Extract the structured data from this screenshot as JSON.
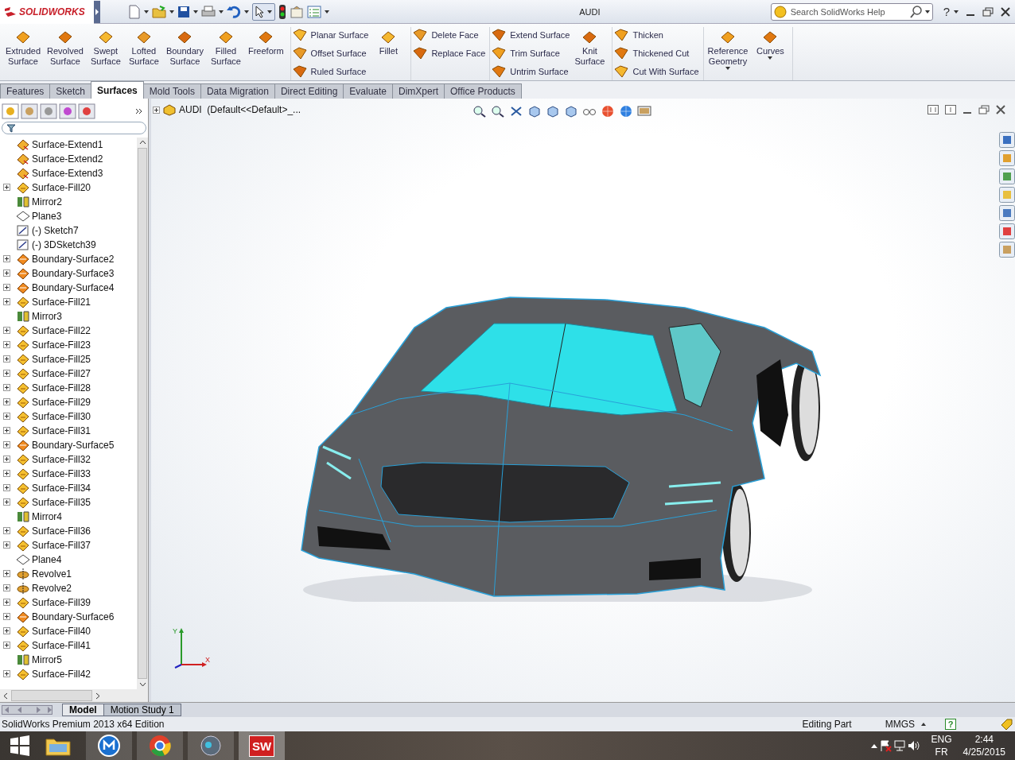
{
  "title_bar": {
    "logo": "SOLIDWORKS",
    "title": "AUDI",
    "search": {
      "placeholder": "Search SolidWorks Help"
    },
    "help": "?"
  },
  "ribbon": {
    "groups": [
      {
        "columns": [
          {
            "kind": "large",
            "label": "Extruded\nSurface",
            "dropdown": false
          },
          {
            "kind": "large",
            "label": "Revolved\nSurface",
            "dropdown": false
          },
          {
            "kind": "large",
            "label": "Swept\nSurface",
            "dropdown": false
          },
          {
            "kind": "large",
            "label": "Lofted\nSurface",
            "dropdown": false
          },
          {
            "kind": "large",
            "label": "Boundary\nSurface",
            "dropdown": false
          },
          {
            "kind": "large",
            "label": "Filled\nSurface",
            "dropdown": false
          },
          {
            "kind": "large",
            "label": "Freeform",
            "dropdown": false
          }
        ]
      },
      {
        "columns": [
          {
            "kind": "stack",
            "items": [
              "Planar Surface",
              "Offset Surface",
              "Ruled Surface"
            ]
          },
          {
            "kind": "large",
            "label": "Fillet",
            "dropdown": false
          }
        ]
      },
      {
        "columns": [
          {
            "kind": "stack",
            "items": [
              "Delete Face",
              "Replace Face"
            ]
          }
        ]
      },
      {
        "columns": [
          {
            "kind": "stack",
            "items": [
              "Extend Surface",
              "Trim Surface",
              "Untrim Surface"
            ]
          },
          {
            "kind": "large",
            "label": "Knit\nSurface",
            "dropdown": false
          }
        ]
      },
      {
        "columns": [
          {
            "kind": "stack",
            "items": [
              "Thicken",
              "Thickened Cut",
              "Cut With Surface"
            ]
          }
        ]
      },
      {
        "columns": [
          {
            "kind": "large",
            "label": "Reference\nGeometry",
            "dropdown": true
          },
          {
            "kind": "large",
            "label": "Curves",
            "dropdown": true
          }
        ]
      }
    ]
  },
  "command_tabs": [
    {
      "label": "Features",
      "selected": false
    },
    {
      "label": "Sketch",
      "selected": false
    },
    {
      "label": "Surfaces",
      "selected": true
    },
    {
      "label": "Mold Tools",
      "selected": false
    },
    {
      "label": "Data Migration",
      "selected": false
    },
    {
      "label": "Direct Editing",
      "selected": false
    },
    {
      "label": "Evaluate",
      "selected": false
    },
    {
      "label": "DimXpert",
      "selected": false
    },
    {
      "label": "Office Products",
      "selected": false
    }
  ],
  "feature_manager": {
    "header": "AUDI  (Default<<Default>_...",
    "items": [
      {
        "name": "Surface-Extend1",
        "kind": "extend",
        "expandable": false
      },
      {
        "name": "Surface-Extend2",
        "kind": "extend",
        "expandable": false
      },
      {
        "name": "Surface-Extend3",
        "kind": "extend",
        "expandable": false
      },
      {
        "name": "Surface-Fill20",
        "kind": "fill",
        "expandable": true
      },
      {
        "name": "Mirror2",
        "kind": "mirror",
        "expandable": false
      },
      {
        "name": "Plane3",
        "kind": "plane",
        "expandable": false
      },
      {
        "name": "(-) Sketch7",
        "kind": "sketch",
        "expandable": false
      },
      {
        "name": "(-) 3DSketch39",
        "kind": "sketch",
        "expandable": false
      },
      {
        "name": "Boundary-Surface2",
        "kind": "boundary",
        "expandable": true
      },
      {
        "name": "Boundary-Surface3",
        "kind": "boundary",
        "expandable": true
      },
      {
        "name": "Boundary-Surface4",
        "kind": "boundary",
        "expandable": true
      },
      {
        "name": "Surface-Fill21",
        "kind": "fill",
        "expandable": true
      },
      {
        "name": "Mirror3",
        "kind": "mirror",
        "expandable": false
      },
      {
        "name": "Surface-Fill22",
        "kind": "fill",
        "expandable": true
      },
      {
        "name": "Surface-Fill23",
        "kind": "fill",
        "expandable": true
      },
      {
        "name": "Surface-Fill25",
        "kind": "fill",
        "expandable": true
      },
      {
        "name": "Surface-Fill27",
        "kind": "fill",
        "expandable": true
      },
      {
        "name": "Surface-Fill28",
        "kind": "fill",
        "expandable": true
      },
      {
        "name": "Surface-Fill29",
        "kind": "fill",
        "expandable": true
      },
      {
        "name": "Surface-Fill30",
        "kind": "fill",
        "expandable": true
      },
      {
        "name": "Surface-Fill31",
        "kind": "fill",
        "expandable": true
      },
      {
        "name": "Boundary-Surface5",
        "kind": "boundary",
        "expandable": true
      },
      {
        "name": "Surface-Fill32",
        "kind": "fill",
        "expandable": true
      },
      {
        "name": "Surface-Fill33",
        "kind": "fill",
        "expandable": true
      },
      {
        "name": "Surface-Fill34",
        "kind": "fill",
        "expandable": true
      },
      {
        "name": "Surface-Fill35",
        "kind": "fill",
        "expandable": true
      },
      {
        "name": "Mirror4",
        "kind": "mirror",
        "expandable": false
      },
      {
        "name": "Surface-Fill36",
        "kind": "fill",
        "expandable": true
      },
      {
        "name": "Surface-Fill37",
        "kind": "fill",
        "expandable": true
      },
      {
        "name": "Plane4",
        "kind": "plane",
        "expandable": false
      },
      {
        "name": "Revolve1",
        "kind": "revolve",
        "expandable": true
      },
      {
        "name": "Revolve2",
        "kind": "revolve",
        "expandable": true
      },
      {
        "name": "Surface-Fill39",
        "kind": "fill",
        "expandable": true
      },
      {
        "name": "Boundary-Surface6",
        "kind": "boundary",
        "expandable": true
      },
      {
        "name": "Surface-Fill40",
        "kind": "fill",
        "expandable": true
      },
      {
        "name": "Surface-Fill41",
        "kind": "fill",
        "expandable": true
      },
      {
        "name": "Mirror5",
        "kind": "mirror",
        "expandable": false
      },
      {
        "name": "Surface-Fill42",
        "kind": "fill",
        "expandable": true
      }
    ]
  },
  "triad": {
    "y": "Y",
    "x": "X"
  },
  "view_tabs": [
    {
      "label": "Model",
      "selected": true
    },
    {
      "label": "Motion Study 1",
      "selected": false
    }
  ],
  "status_bar": {
    "product": "SolidWorks Premium 2013 x64 Edition",
    "mode": "Editing Part",
    "units": "MMGS",
    "help": "?"
  },
  "taskbar": {
    "apps": [
      {
        "kind": "folder",
        "selected": false
      },
      {
        "kind": "browser-m",
        "selected": false
      },
      {
        "kind": "chrome",
        "selected": false
      },
      {
        "kind": "media",
        "selected": false
      },
      {
        "kind": "sw",
        "label": "SW",
        "selected": true
      }
    ],
    "language": "ENG",
    "layout": "FR",
    "time": "2:44",
    "date": "4/25/2015"
  }
}
